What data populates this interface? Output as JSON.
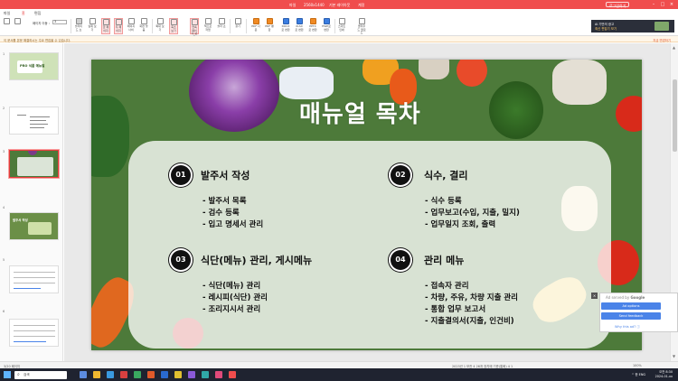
{
  "titlebar": {
    "file_label": "파일",
    "doc_name": "2560x1440",
    "ext_label": "기본 레이아웃",
    "user_label": "계정",
    "login": "로그인하기"
  },
  "menu_tabs": [
    "파일",
    "홈",
    "편집",
    "보기",
    "삽입"
  ],
  "ribbon": {
    "zoom_label": "페이지 이동 :",
    "zoom_value": "3",
    "buttons": [
      {
        "label": "슬라이드 쇼",
        "color": "gray"
      },
      {
        "label": "실제 보기",
        "color": "gray"
      },
      {
        "label": "한 페이지",
        "color": "gray",
        "hl": true
      },
      {
        "label": "두 페이지",
        "color": "gray",
        "hl": true
      },
      {
        "label": "페이지 너비",
        "color": "gray"
      },
      {
        "label": "화면 맞춤",
        "color": "gray"
      },
      {
        "label": "확대 보기",
        "color": "gray"
      },
      {
        "label": "축소 보기",
        "color": "gray",
        "hl": true
      },
      {
        "label": "연속 페이지 보기",
        "color": "gray",
        "hl": true
      },
      {
        "label": "책으로 작업",
        "color": "gray"
      },
      {
        "label": "슬라 쇼",
        "color": "gray"
      },
      {
        "label": "찾기",
        "color": "gray"
      },
      {
        "label": "PDF 다운",
        "color": "orange"
      },
      {
        "label": "PDF 병합",
        "color": "orange"
      },
      {
        "label": "DOCX로 변환",
        "color": "blue"
      },
      {
        "label": "XLSX로 변환",
        "color": "blue"
      },
      {
        "label": "PPTX로 변환",
        "color": "orange"
      },
      {
        "label": "HWP로 변환",
        "color": "blue"
      },
      {
        "label": "스마트 인쇄",
        "color": "gray"
      },
      {
        "label": "클라우드 업로드",
        "color": "gray"
      }
    ]
  },
  "ad_banner": {
    "line1": "AI 기반의 광고",
    "line2": "최신 편집기 보기"
  },
  "notice": {
    "text": "이 문서를 본문 해결하시는 주요 편집을 수 있습니다.",
    "link": "지금 변경하기"
  },
  "slides": [
    {
      "num": "1",
      "title": "PRO 식품 메뉴얼"
    },
    {
      "num": "2"
    },
    {
      "num": "3"
    },
    {
      "num": "4",
      "title": "발주서 작성"
    },
    {
      "num": "5"
    },
    {
      "num": "6"
    }
  ],
  "slide": {
    "title": "매뉴얼 목차",
    "sections": [
      {
        "num": "01",
        "head": "발주서 작성",
        "items": [
          "- 발주서 목록",
          "- 검수 등록",
          "- 입고 명세서 관리"
        ]
      },
      {
        "num": "02",
        "head": "식수, 결리",
        "items": [
          "- 식수 등록",
          "- 업무보고(수입, 지출, 밀지)",
          "- 업무일지 조회, 출력"
        ]
      },
      {
        "num": "03",
        "head": "식단(메뉴) 관리, 게시메뉴",
        "items": [
          "- 식단(메뉴) 관리",
          "- 레시피(식단) 관리",
          "- 조리지시서 관리"
        ]
      },
      {
        "num": "04",
        "head": "관리 메뉴",
        "items": [
          "- 접속자 관리",
          "- 차량, 주유, 차량 지출 관리",
          "- 통합 업무 보고서",
          "- 지출결의서(지출, 인건비)"
        ]
      }
    ]
  },
  "adsense": {
    "head_prefix": "Ad served by",
    "head_brand": "Google",
    "options": "Ad options",
    "feedback": "Send feedback",
    "why": "Why this ad? ⓘ"
  },
  "statusbar": {
    "left": "3/20 페이지",
    "middle": "2023년 1 보관 4 26개 장치에 기준(통화) 4 1",
    "right": "100%"
  },
  "taskbar": {
    "search": "검색",
    "tray": "^ 한 ENG",
    "time": "오전 8:30",
    "date": "2024-01-xx"
  }
}
